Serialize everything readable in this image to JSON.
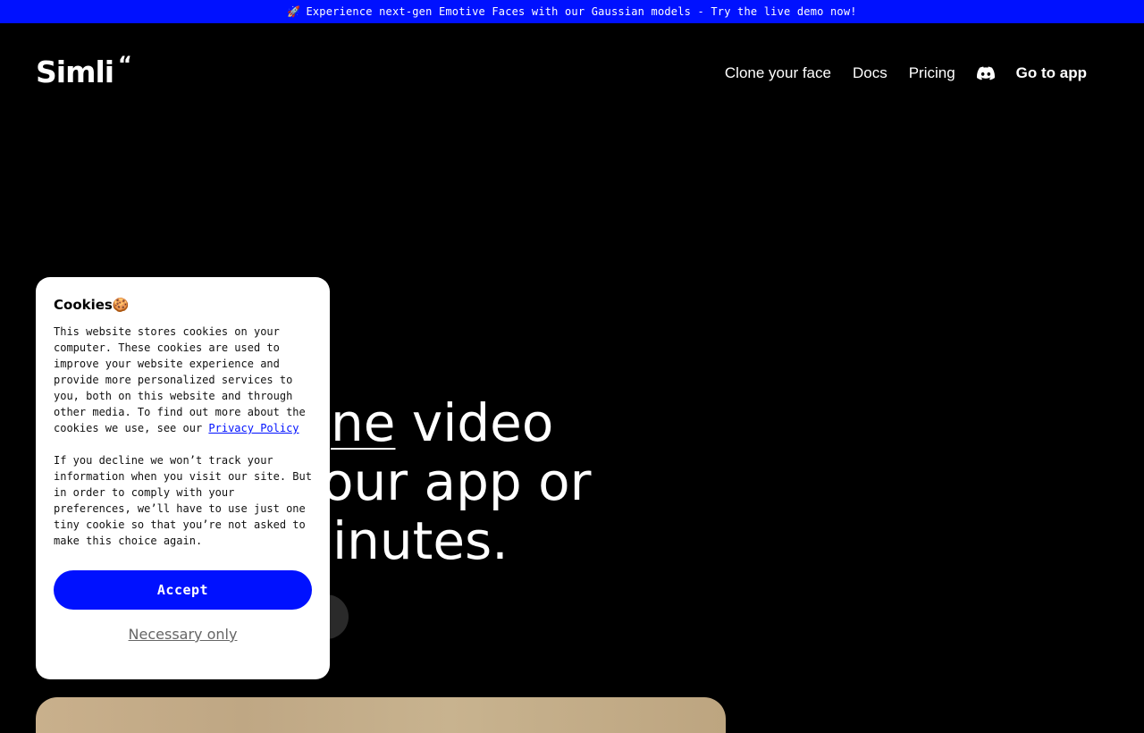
{
  "announcement": {
    "icon": "rocket-icon",
    "text": "Experience next-gen Emotive Faces with our Gaussian models - Try the live demo now!"
  },
  "header": {
    "logo_text": "Simli",
    "logo_mark": "“",
    "nav": {
      "clone_face": "Clone your face",
      "docs": "Docs",
      "pricing": "Pricing",
      "discord_icon": "discord-icon",
      "go_to_app": "Go to app"
    }
  },
  "hero": {
    "line1_prefix": "",
    "line1_underlined": "ne",
    "line1_rest": " video",
    "line2": "our app or",
    "line3": "inutes."
  },
  "cookie": {
    "title": "Cookies🍪",
    "para1": "This website stores cookies on your computer. These cookies are used to improve your website experience and provide more personalized services to you, both on this website and through other media. To find out more about the cookies we use, see our ",
    "privacy_link": "Privacy Policy",
    "para2": "If you decline we won’t track your information when you visit our site. But in order to comply with your preferences, we’ll have to use just one tiny cookie so that you’re not asked to make this choice again.",
    "accept": "Accept",
    "necessary_only": "Necessary only"
  },
  "colors": {
    "brand_blue": "#0011ff",
    "background": "#000000"
  }
}
